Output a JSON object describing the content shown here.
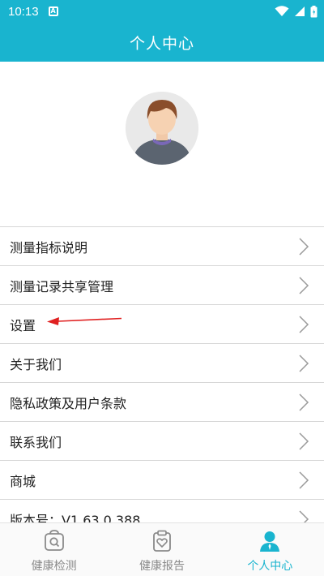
{
  "status_bar": {
    "time": "10:13",
    "notification_letter": "A"
  },
  "header": {
    "title": "个人中心"
  },
  "menu": {
    "items": [
      {
        "label": "测量指标说明"
      },
      {
        "label": "测量记录共享管理"
      },
      {
        "label": "设置"
      },
      {
        "label": "关于我们"
      },
      {
        "label": "隐私政策及用户条款"
      },
      {
        "label": "联系我们"
      },
      {
        "label": "商城"
      },
      {
        "label": "版本号：V1.63.0.388"
      }
    ]
  },
  "tabbar": {
    "tabs": [
      {
        "label": "健康检测",
        "icon": "search-bag-icon",
        "active": false
      },
      {
        "label": "健康报告",
        "icon": "clipboard-heart-icon",
        "active": false
      },
      {
        "label": "个人中心",
        "icon": "person-icon",
        "active": true
      }
    ]
  },
  "colors": {
    "primary": "#19b4cf",
    "annotation": "#e02020",
    "inactive": "#8a8a8a"
  }
}
